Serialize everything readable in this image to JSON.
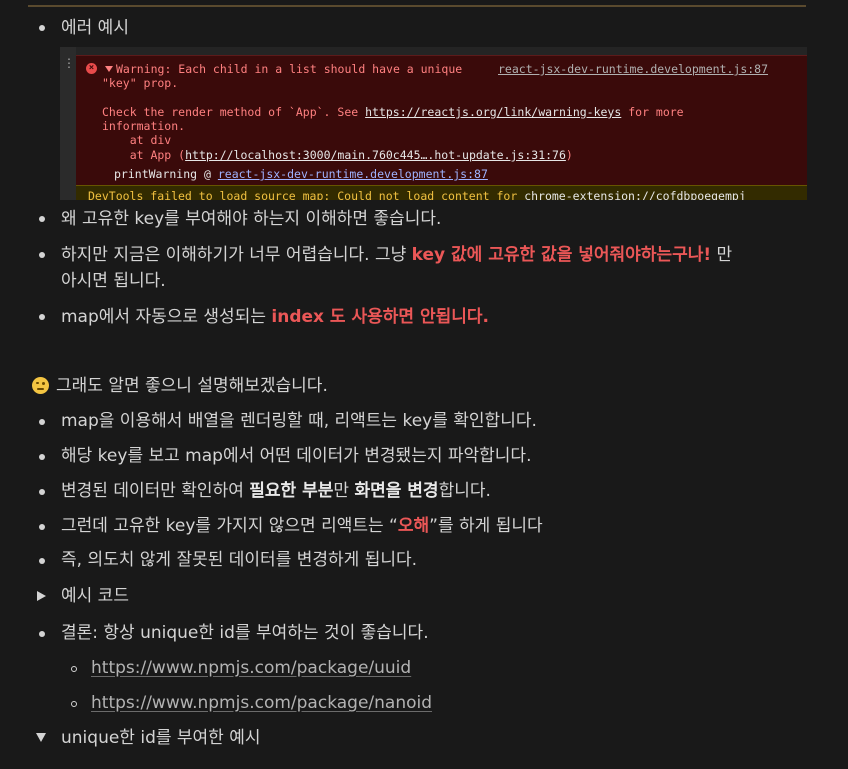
{
  "items": {
    "error_example": "에러 예시",
    "why_key": "왜 고유한 key를 부여해야 하는지 이해하면 좋습니다.",
    "hard_line1_a": "하지만 지금은 이해하기가 너무 어렵습니다. 그냥 ",
    "hard_line1_red": "key 값에 고유한 값을 넣어줘야하는구나!",
    "hard_line1_b": " 만",
    "hard_line2": "아시면 됩니다.",
    "map_a": "map에서 자동으로 생성되는 ",
    "map_red": "index 도 사용하면 안됩니다.",
    "callout": "그래도 알면 좋으니 설명해보겠습니다.",
    "expl1": "map을 이용해서 배열을 렌더링할 때, 리액트는 key를 확인합니다.",
    "expl2": "해당 key를 보고 map에서 어떤 데이터가 변경됐는지 파악합니다.",
    "expl3_a": "변경된 데이터만 확인하여 ",
    "expl3_b1": "필요한 부분",
    "expl3_c": "만 ",
    "expl3_b2": "화면을 변경",
    "expl3_d": "합니다.",
    "expl4_a": "그런데 고유한 key를 가지지 않으면 리액트는 “",
    "expl4_red": "오해",
    "expl4_b": "”를 하게 됩니다",
    "expl5": "즉, 의도치 않게 잘못된 데이터를 변경하게 됩니다.",
    "toggle_code": "예시 코드",
    "conclusion": "결론: 항상 unique한 id를 부여하는 것이 좋습니다.",
    "link_uuid": "https://www.npmjs.com/package/uuid",
    "link_nanoid": "https://www.npmjs.com/package/nanoid",
    "toggle_unique": "unique한 id를 부여한 예시"
  },
  "console": {
    "gutter": "⋮",
    "warning_l1": "Warning: Each child in a list should have a unique",
    "source_link": "react-jsx-dev-runtime.development.js:87",
    "warning_l2": "\"key\" prop.",
    "check_a": "Check the render method of `App`. See ",
    "check_link": "https://reactjs.org/link/warning-keys",
    "check_b": " for more",
    "info": "information.",
    "at_div": "    at div",
    "at_app_a": "    at App (",
    "at_app_link": "http://localhost:3000/main.760c445….hot-update.js:31:76",
    "at_app_b": ")",
    "print_a": "printWarning @ ",
    "print_link": "react-jsx-dev-runtime.development.js:87",
    "devtools_a": "DevTools failed to load source map: Could not load content for ",
    "devtools_b": "chrome-extension://cofdbpoegempj"
  },
  "colors": {
    "accent_red": "#eb5757",
    "background": "#191919"
  }
}
